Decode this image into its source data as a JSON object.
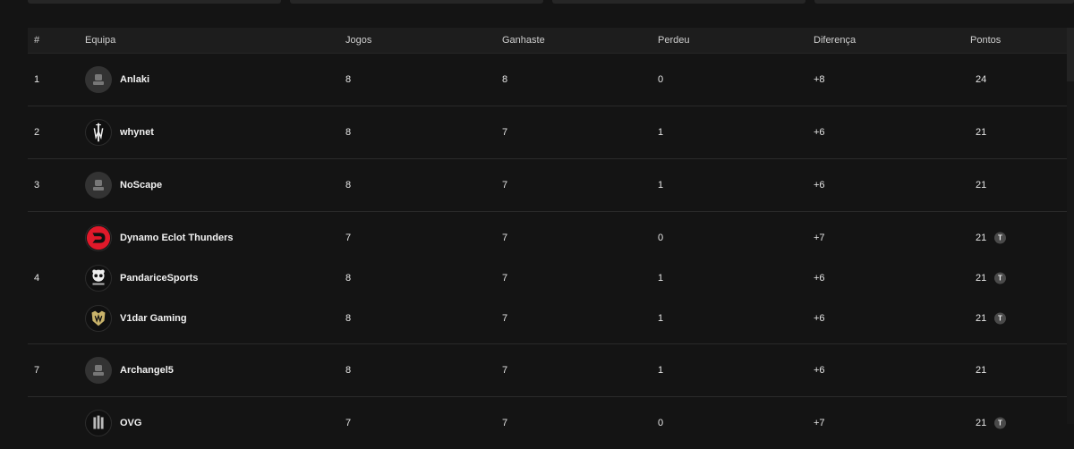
{
  "columns": {
    "rank": "#",
    "team": "Equipa",
    "games": "Jogos",
    "won": "Ganhaste",
    "lost": "Perdeu",
    "diff": "Diferença",
    "points": "Pontos"
  },
  "tie_label": "T",
  "standings": [
    {
      "rank": "1",
      "teams": [
        {
          "name": "Anlaki",
          "logo": "avatar-placeholder-icon",
          "games": "8",
          "won": "8",
          "lost": "0",
          "diff": "+8",
          "points": "24"
        }
      ]
    },
    {
      "rank": "2",
      "teams": [
        {
          "name": "whynet",
          "logo": "whynet-logo",
          "games": "8",
          "won": "7",
          "lost": "1",
          "diff": "+6",
          "points": "21"
        }
      ]
    },
    {
      "rank": "3",
      "teams": [
        {
          "name": "NoScape",
          "logo": "avatar-placeholder-icon",
          "games": "8",
          "won": "7",
          "lost": "1",
          "diff": "+6",
          "points": "21"
        }
      ]
    },
    {
      "rank": "4",
      "teams": [
        {
          "name": "Dynamo Eclot Thunders",
          "logo": "dynamo-logo",
          "games": "7",
          "won": "7",
          "lost": "0",
          "diff": "+7",
          "points": "21",
          "tie": true
        },
        {
          "name": "PandariceSports",
          "logo": "pandarice-logo",
          "games": "8",
          "won": "7",
          "lost": "1",
          "diff": "+6",
          "points": "21",
          "tie": true
        },
        {
          "name": "V1dar Gaming",
          "logo": "v1dar-logo",
          "games": "8",
          "won": "7",
          "lost": "1",
          "diff": "+6",
          "points": "21",
          "tie": true
        }
      ]
    },
    {
      "rank": "7",
      "teams": [
        {
          "name": "Archangel5",
          "logo": "avatar-placeholder-icon",
          "games": "8",
          "won": "7",
          "lost": "1",
          "diff": "+6",
          "points": "21"
        }
      ]
    },
    {
      "rank": "",
      "teams": [
        {
          "name": "OVG",
          "logo": "ovg-logo",
          "games": "7",
          "won": "7",
          "lost": "0",
          "diff": "+7",
          "points": "21",
          "tie": true
        }
      ]
    }
  ],
  "colors": {
    "background": "#141414",
    "header": "#1d1d1d",
    "divider": "#2a2a2a",
    "dynamo_red": "#e0192a",
    "v1dar_gold": "#c9b36a"
  }
}
